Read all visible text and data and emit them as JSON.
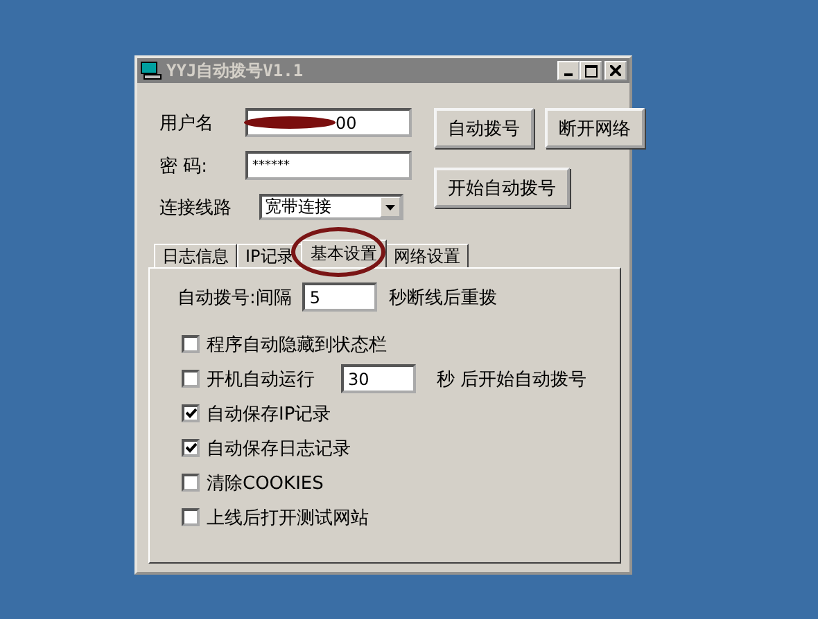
{
  "window": {
    "title": "YYJ自动拨号V1.1"
  },
  "login": {
    "username_label": "用户名",
    "username_value": "00",
    "password_label": "密 码:",
    "password_value": "******",
    "line_label": "连接线路",
    "line_value": "宽带连接"
  },
  "buttons": [
    "自动拨号",
    "断开网络",
    "开始自动拨号"
  ],
  "tabs": [
    {
      "label": "日志信息",
      "selected": false
    },
    {
      "label": "IP记录",
      "selected": false
    },
    {
      "label": "基本设置",
      "selected": true
    },
    {
      "label": "网络设置",
      "selected": false
    }
  ],
  "interval": {
    "label": "自动拨号:间隔",
    "value": "5",
    "suffix": "秒断线后重拨"
  },
  "options": [
    {
      "kind": "checkbox",
      "label": "程序自动隐藏到状态栏",
      "checked": false
    },
    {
      "kind": "delay",
      "label": "开机自动运行",
      "checked": false,
      "value": "30",
      "suffix": "秒 后开始自动拨号"
    },
    {
      "kind": "checkbox",
      "label": "自动保存IP记录",
      "checked": true
    },
    {
      "kind": "checkbox",
      "label": "自动保存日志记录",
      "checked": true
    },
    {
      "kind": "checkbox",
      "label": "清除COOKIES",
      "checked": false
    },
    {
      "kind": "checkbox",
      "label": "上线后打开测试网站",
      "checked": false
    }
  ]
}
